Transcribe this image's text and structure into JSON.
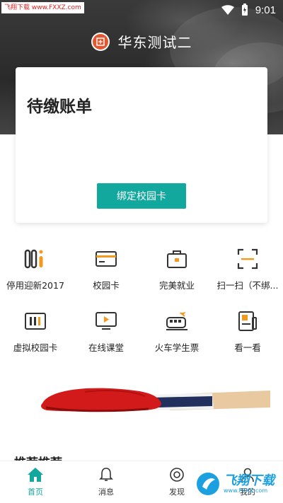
{
  "status_bar": {
    "watermark": "飞翔下载 www.FXXZ.com",
    "time": "9:01"
  },
  "header": {
    "school_name": "华东测试二"
  },
  "bill_card": {
    "title": "待缴账单",
    "bind_button": "绑定校园卡"
  },
  "grid": {
    "items": [
      {
        "label": "停用迎新2017",
        "icon": "welcome-icon"
      },
      {
        "label": "校园卡",
        "icon": "card-icon"
      },
      {
        "label": "完美就业",
        "icon": "briefcase-icon"
      },
      {
        "label": "扫一扫（不绑...",
        "icon": "scan-icon"
      },
      {
        "label": "虚拟校园卡",
        "icon": "virtual-card-icon"
      },
      {
        "label": "在线课堂",
        "icon": "video-class-icon"
      },
      {
        "label": "火车学生票",
        "icon": "train-icon"
      },
      {
        "label": "看一看",
        "icon": "reader-icon"
      }
    ]
  },
  "section": {
    "peek_title": "推荐推荐"
  },
  "tabbar": {
    "items": [
      {
        "label": "首页",
        "active": true
      },
      {
        "label": "消息",
        "active": false
      },
      {
        "label": "发现",
        "active": false
      },
      {
        "label": "我的",
        "active": false
      }
    ]
  },
  "corner_watermark": {
    "text": "飞翔下载",
    "sub": "www.FXXZ.com"
  },
  "colors": {
    "accent": "#13a89e",
    "orange": "#f39a1e"
  }
}
